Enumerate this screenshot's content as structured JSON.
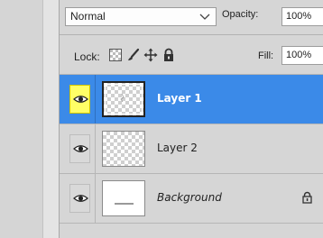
{
  "toolbar": {
    "blend_mode": "Normal",
    "opacity_label": "Opacity:",
    "opacity_value": "100%",
    "lock_label": "Lock:",
    "fill_label": "Fill:",
    "fill_value": "100%"
  },
  "lock_icons": [
    "lock-transparent-pixels-icon",
    "lock-image-pixels-icon",
    "lock-position-icon",
    "lock-all-icon"
  ],
  "layers": [
    {
      "name": "Layer 1",
      "selected": true,
      "visible": true,
      "thumbnail": "transparent",
      "locked": false
    },
    {
      "name": "Layer 2",
      "selected": false,
      "visible": true,
      "thumbnail": "transparent",
      "locked": false
    },
    {
      "name": "Background",
      "selected": false,
      "visible": true,
      "thumbnail": "white",
      "locked": true
    }
  ],
  "colors": {
    "selection": "#3b8ae8",
    "active_eye": "#ffff66",
    "panel": "#d6d6d6"
  }
}
